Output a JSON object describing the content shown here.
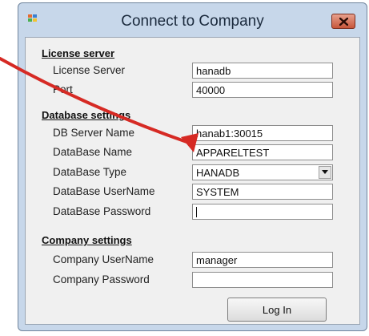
{
  "window": {
    "title": "Connect to Company"
  },
  "license_section": {
    "heading": "License server",
    "fields": [
      {
        "label": "License Server",
        "value": "hanadb"
      },
      {
        "label": "Port",
        "value": "40000"
      }
    ]
  },
  "database_section": {
    "heading": "Database settings",
    "server": {
      "label": "DB Server Name",
      "value": "hanab1:30015"
    },
    "name": {
      "label": "DataBase Name",
      "value": "APPARELTEST"
    },
    "type": {
      "label": "DataBase Type",
      "value": "HANADB"
    },
    "user": {
      "label": "DataBase UserName",
      "value": "SYSTEM"
    },
    "password": {
      "label": "DataBase Password",
      "value": ""
    }
  },
  "company_section": {
    "heading": "Company settings",
    "user": {
      "label": "Company UserName",
      "value": "manager"
    },
    "password": {
      "label": "Company Password",
      "value": ""
    }
  },
  "actions": {
    "login_label": "Log In"
  },
  "colors": {
    "annotation_arrow": "#d62a24",
    "title_bar": "#c7d7ea",
    "close_button": "#c8563a"
  },
  "icons": {
    "app": "app-icon",
    "close": "close-icon",
    "dropdown": "chevron-down-icon"
  }
}
